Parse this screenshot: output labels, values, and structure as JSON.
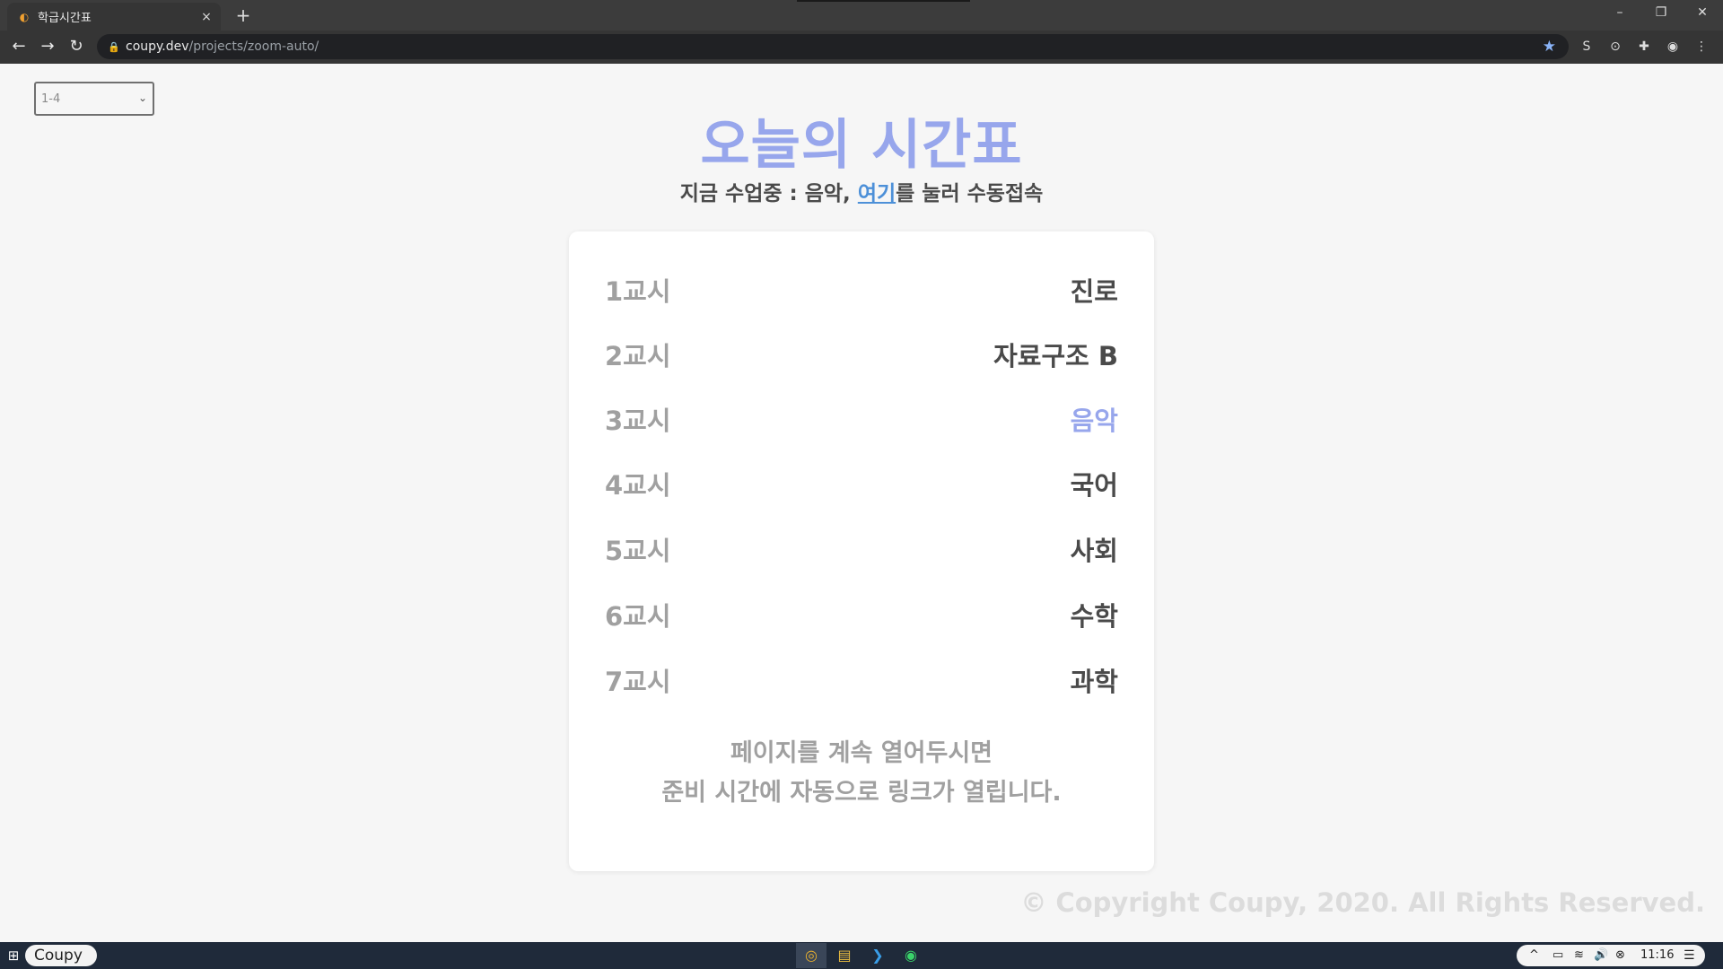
{
  "browser": {
    "tab_title": "학급시간표",
    "tab_favicon": "coupy-favicon",
    "tab_close": "×",
    "new_tab": "+",
    "url_host": "coupy.dev",
    "url_path": "/projects/zoom-auto/",
    "minimize": "–",
    "restore": "❐",
    "close": "✕",
    "back": "←",
    "forward": "→",
    "reload": "↻",
    "lock": "🔒",
    "star": "★",
    "ext_s": "S",
    "ext_circle": "⊙",
    "ext_puzzle": "✚",
    "profile": "◉",
    "menu": "⋮"
  },
  "page": {
    "class_select": {
      "value": "1-4",
      "chevron": "⌄"
    },
    "title": "오늘의 시간표",
    "subtitle_prefix": "지금 수업중 : 음악, ",
    "subtitle_link": "여기",
    "subtitle_suffix": "를 눌러 수동접속",
    "schedule": [
      {
        "period": "1교시",
        "subject": "진로"
      },
      {
        "period": "2교시",
        "subject": "자료구조 B"
      },
      {
        "period": "3교시",
        "subject": "음악"
      },
      {
        "period": "4교시",
        "subject": "국어"
      },
      {
        "period": "5교시",
        "subject": "사회"
      },
      {
        "period": "6교시",
        "subject": "수학"
      },
      {
        "period": "7교시",
        "subject": "과학"
      }
    ],
    "current_period_index": 2,
    "notice_line1": "페이지를 계속 열어두시면",
    "notice_line2": "준비 시간에 자동으로 링크가 열립니다.",
    "copyright": "© Copyright Coupy, 2020. All Rights Reserved."
  },
  "colors": {
    "accent": "#97a6ec",
    "link": "#4d90d8",
    "period_text": "#a0a0a0",
    "subject_text": "#4a4a4a"
  },
  "taskbar": {
    "start": "⊞",
    "search_label": "Coupy",
    "apps": [
      "chrome-icon",
      "folder-icon",
      "vscode-icon",
      "green-app-icon"
    ],
    "tray_up": "^",
    "tray_battery": "▭",
    "tray_wifi": "≋",
    "tray_volume": "🔊",
    "tray_x": "⊗",
    "clock": "11:16",
    "notifications": "☰"
  }
}
